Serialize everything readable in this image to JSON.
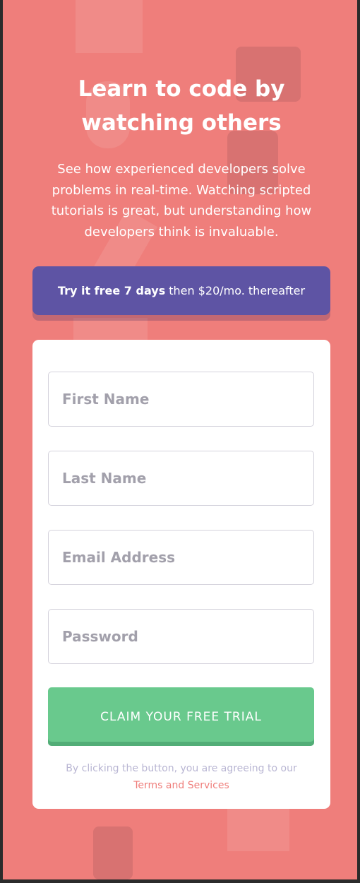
{
  "hero": {
    "title_line1": "Learn to code by",
    "title_line2": "watching others",
    "description": "See how experienced developers solve problems in real-time. Watching scripted tutorials is great, but understanding how developers think is invaluable."
  },
  "promo": {
    "bold": "Try it free 7 days",
    "rest": "then $20/mo. thereafter"
  },
  "form": {
    "first_name": {
      "placeholder": "First Name",
      "value": ""
    },
    "last_name": {
      "placeholder": "Last Name",
      "value": ""
    },
    "email": {
      "placeholder": "Email Address",
      "value": ""
    },
    "password": {
      "placeholder": "Password",
      "value": ""
    },
    "submit_label": "CLAIM YOUR FREE TRIAL",
    "terms_text": "By clicking the button, you are agreeing to our",
    "terms_link": "Terms and Services"
  },
  "colors": {
    "background": "#ef7e7b",
    "promo": "#5e54a4",
    "submit": "#69c98d",
    "card": "#ffffff",
    "placeholder": "#a2a0ab",
    "terms_text": "#b9b6d3"
  },
  "icons": [
    "house-icon",
    "briefcase-icon",
    "network-icon",
    "lock-icon",
    "document-icon",
    "pencil-icon",
    "calculator-icon"
  ]
}
